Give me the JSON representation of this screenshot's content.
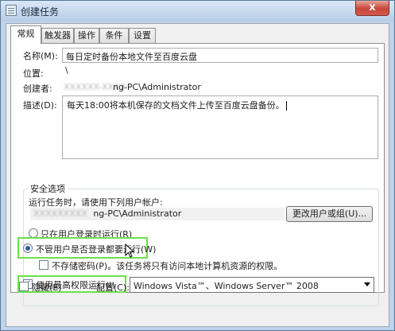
{
  "window": {
    "title": "创建任务",
    "close_glyph": "x"
  },
  "tabs": [
    {
      "label": "常规",
      "active": true
    },
    {
      "label": "触发器",
      "active": false
    },
    {
      "label": "操作",
      "active": false
    },
    {
      "label": "条件",
      "active": false
    },
    {
      "label": "设置",
      "active": false
    }
  ],
  "general": {
    "name_label": "名称(M):",
    "name_value": "每日定时备份本地文件至百度云盘",
    "location_label": "位置:",
    "location_value": "\\",
    "author_label": "创建者:",
    "author_value_hidden": "XXXXXX-XXXX",
    "author_value": "ng-PC\\Administrator",
    "description_label": "描述(D):",
    "description_value": "每天18:00将本机保存的文档文件上传至百度云盘备份。"
  },
  "security": {
    "group_title": "安全选项",
    "run_as_prompt": "运行任务时，请使用下列用户帐户:",
    "user_hidden": "XXXXXXXXX",
    "user_value": "ng-PC\\Administrator",
    "change_user_button": "更改用户或组(U)...",
    "radio_logged_on": "只在用户登录时运行(R)",
    "radio_whether_logged": "不管用户是否登录都要运行(W)",
    "selected_radio": "whether_logged",
    "no_store_password": "不存储密码(P)。该任务将只有访问本地计算机资源的权限。",
    "no_store_password_checked": false,
    "highest_privileges": "使用最高权限运行(I)",
    "highest_privileges_checked": true
  },
  "footer": {
    "hidden_label": "隐藏(E)",
    "hidden_checked": false,
    "configure_label": "配置(C):",
    "configure_value": "Windows Vista™、Windows Server™ 2008"
  },
  "colors": {
    "highlight": "#6ee04a",
    "selected_radio": "#2c5aa0"
  },
  "icons": [
    "task-icon",
    "close-icon",
    "dropdown-arrow-icon",
    "mouse-cursor-icon"
  ]
}
